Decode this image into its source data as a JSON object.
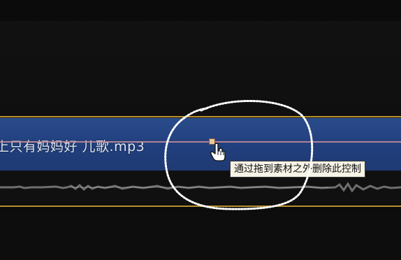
{
  "timeline": {
    "clip_name": "上只有妈妈好 儿歌.mp3",
    "tooltip": "通过拖到素材之外删除此控制",
    "colors": {
      "clip_blue": "#213f7d",
      "track_border": "#b9912f",
      "volume_line": "#c18a96",
      "background": "#0f0f0f"
    }
  },
  "icons": {
    "cursor": "hand-pointer-icon",
    "keyframe": "keyframe-handle-icon"
  }
}
